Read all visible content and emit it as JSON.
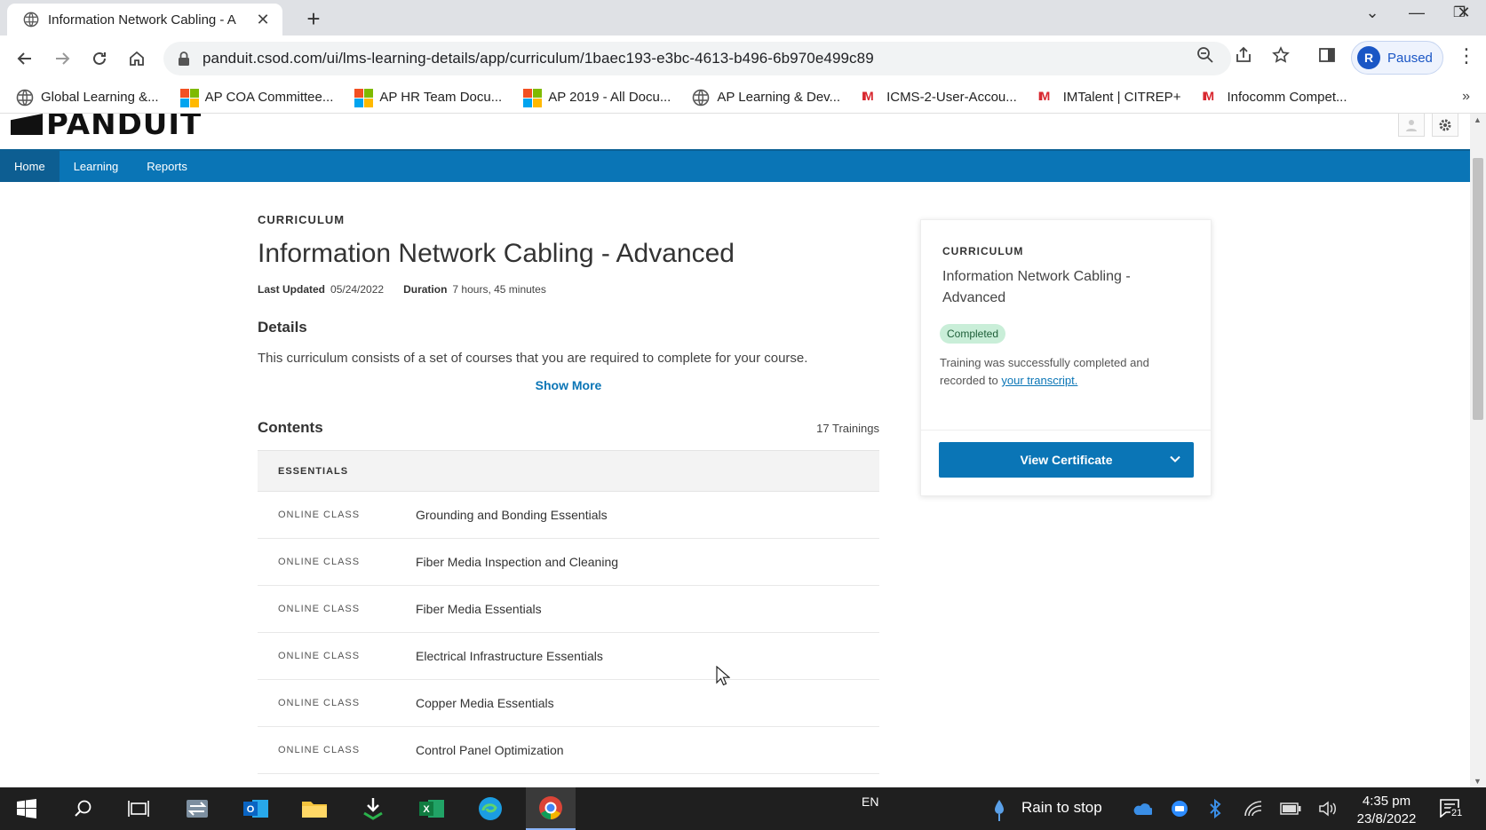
{
  "browser": {
    "tab_title": "Information Network Cabling - A",
    "url": "panduit.csod.com/ui/lms-learning-details/app/curriculum/1baec193-e3bc-4613-b496-6b970e499c89",
    "profile_initial": "R",
    "profile_status": "Paused",
    "bookmarks": [
      {
        "label": "Global Learning &...",
        "icon": "globe-icon"
      },
      {
        "label": "AP COA Committee...",
        "icon": "microsoft-icon"
      },
      {
        "label": "AP HR Team Docu...",
        "icon": "microsoft-icon"
      },
      {
        "label": "AP 2019 - All Docu...",
        "icon": "microsoft-icon"
      },
      {
        "label": "AP Learning & Dev...",
        "icon": "globe-icon"
      },
      {
        "label": "ICMS-2-User-Accou...",
        "icon": "imda-icon"
      },
      {
        "label": "IMTalent | CITREP+",
        "icon": "imda-icon"
      },
      {
        "label": "Infocomm Compet...",
        "icon": "imda-icon"
      }
    ],
    "bookmarks_more": "»"
  },
  "site": {
    "logo_text": "PANDUIT",
    "nav": [
      {
        "label": "Home",
        "active": true
      },
      {
        "label": "Learning",
        "active": false
      },
      {
        "label": "Reports",
        "active": false
      }
    ]
  },
  "main": {
    "eyebrow": "CURRICULUM",
    "title": "Information Network Cabling - Advanced",
    "last_updated_label": "Last Updated",
    "last_updated": "05/24/2022",
    "duration_label": "Duration",
    "duration": "7 hours, 45 minutes",
    "details_heading": "Details",
    "description": "This curriculum consists of a set of courses that you are required to complete for your course.",
    "show_more": "Show More",
    "contents_heading": "Contents",
    "trainings_count": "17 Trainings",
    "section": "ESSENTIALS",
    "items": [
      {
        "type": "ONLINE CLASS",
        "name": "Grounding and Bonding Essentials"
      },
      {
        "type": "ONLINE CLASS",
        "name": "Fiber Media Inspection and Cleaning"
      },
      {
        "type": "ONLINE CLASS",
        "name": "Fiber Media Essentials"
      },
      {
        "type": "ONLINE CLASS",
        "name": "Electrical Infrastructure Essentials"
      },
      {
        "type": "ONLINE CLASS",
        "name": "Copper Media Essentials"
      },
      {
        "type": "ONLINE CLASS",
        "name": "Control Panel Optimization"
      }
    ]
  },
  "card": {
    "eyebrow": "CURRICULUM",
    "title": "Information Network Cabling - Advanced",
    "status": "Completed",
    "message": "Training was successfully completed and recorded to",
    "link": "your transcript.",
    "button": "View Certificate"
  },
  "taskbar": {
    "language": "EN",
    "weather": "Rain to stop",
    "time": "4:35 pm",
    "date": "23/8/2022",
    "notifications": "21"
  },
  "colors": {
    "brand_blue": "#0a75b6",
    "badge_green": "#c9eed8"
  }
}
